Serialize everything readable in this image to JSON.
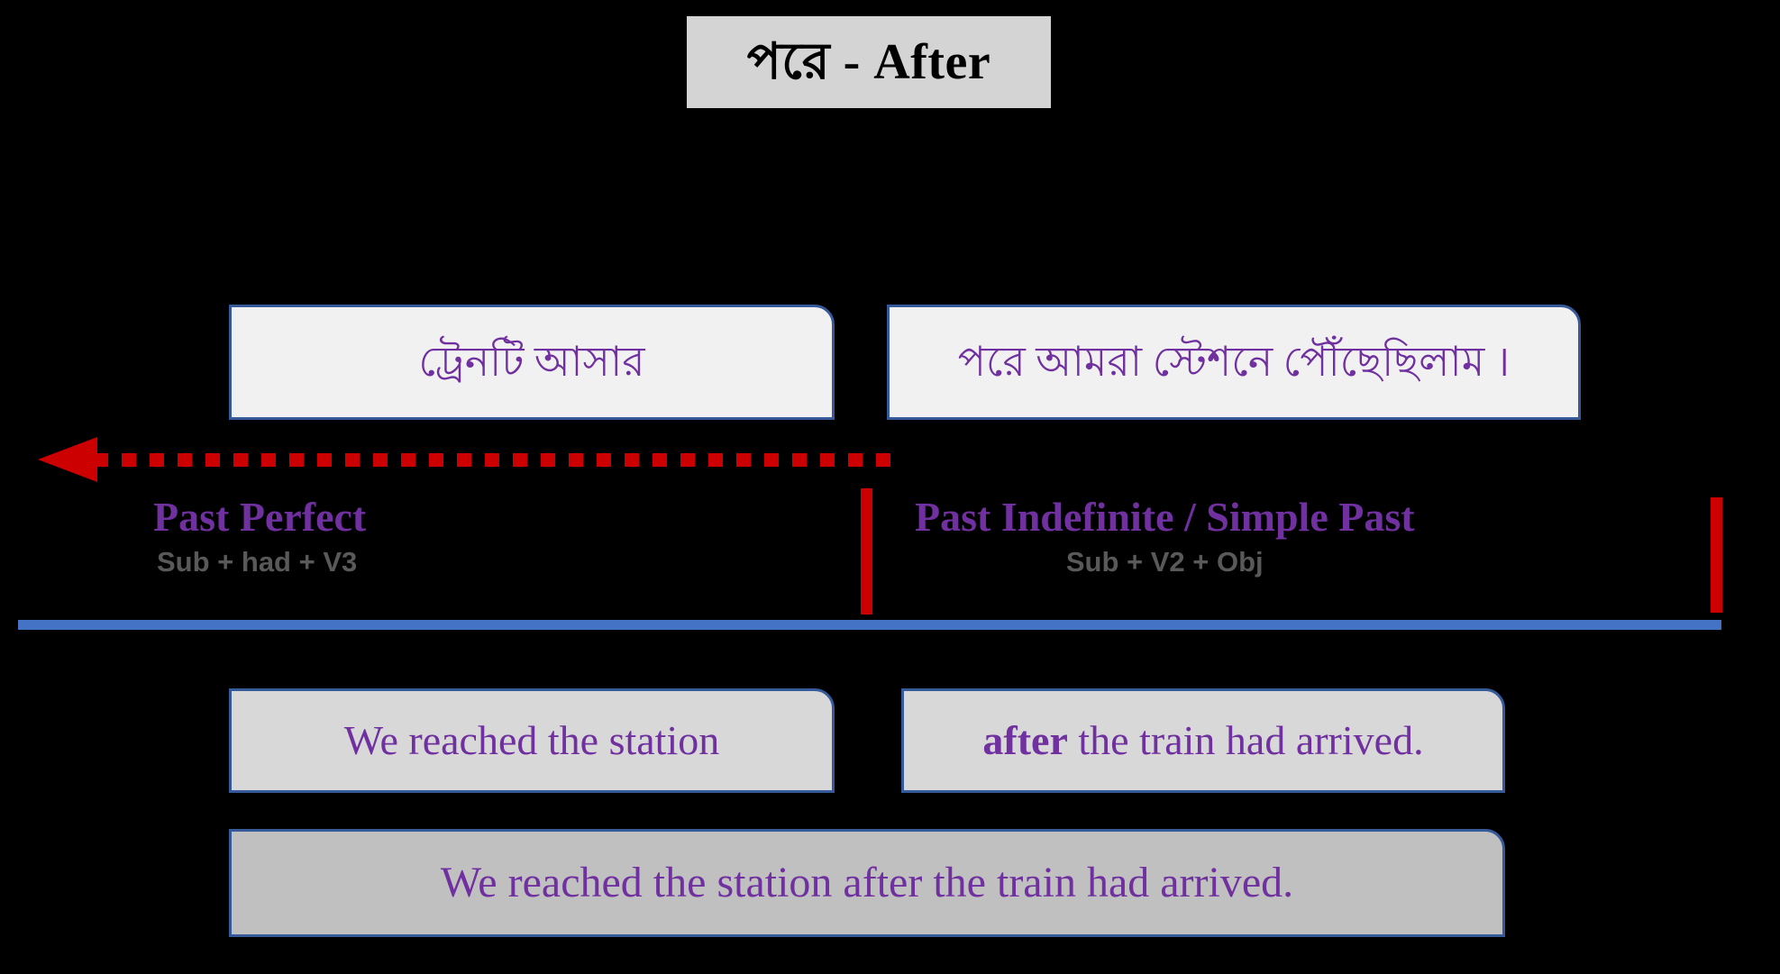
{
  "title": {
    "bangla": "পরে",
    "separator": "-",
    "english": "After",
    "full": "পরে  -  After"
  },
  "colors": {
    "background": "#000000",
    "title_box": "#D4D4D4",
    "purple_text": "#7030A0",
    "box_border_blue": "#36599A",
    "box_fill_white": "#F1F1F1",
    "box_fill_gray": "#D8D8D8",
    "box_fill_gray_dark": "#C0C0C0",
    "arrow_red": "#CC0000",
    "timeline_blue": "#4472C4",
    "formula_gray": "#595959"
  },
  "bangla_clauses": [
    {
      "text": "ট্রেনটি আসার"
    },
    {
      "text": "পরে আমরা স্টেশনে পৌঁছেছিলাম ।"
    }
  ],
  "tenses": [
    {
      "name": "Past Perfect",
      "formula": "Sub + had + V3"
    },
    {
      "name": "Past Indefinite / Simple Past",
      "formula": "Sub + V2 + Obj"
    }
  ],
  "english_clauses": [
    {
      "prefix_bold": "",
      "text": "We reached the station"
    },
    {
      "prefix_bold": "after",
      "text": " the train had arrived."
    }
  ],
  "english_full_sentence": "We reached the station after the train had arrived.",
  "timeline": {
    "arrow_direction": "left",
    "arrow_style": "dotted",
    "arrow_label": "backward-in-time"
  }
}
